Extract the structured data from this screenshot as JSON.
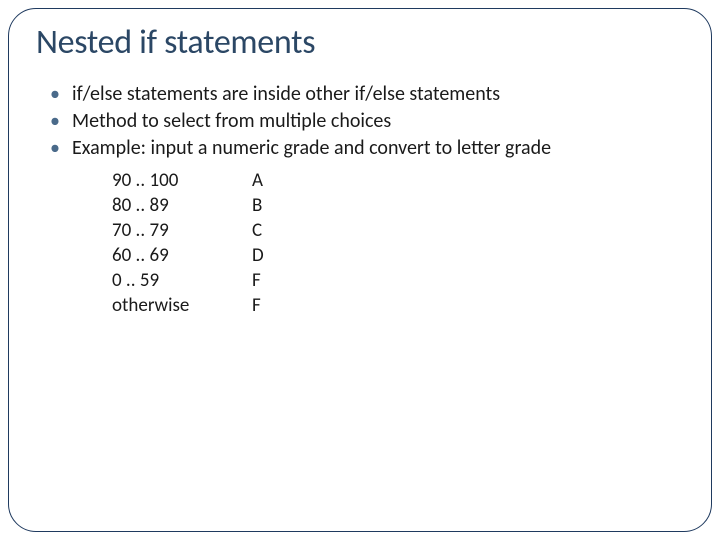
{
  "title": "Nested if statements",
  "bullets": [
    "if/else statements are inside other if/else statements",
    "Method to select from multiple choices",
    "Example: input a numeric grade and convert to letter grade"
  ],
  "grade_rows": [
    {
      "range": "90 .. 100",
      "letter": "A"
    },
    {
      "range": "80 .. 89",
      "letter": "B"
    },
    {
      "range": "70 .. 79",
      "letter": "C"
    },
    {
      "range": "60 .. 69",
      "letter": "D"
    },
    {
      "range": "0   .. 59",
      "letter": "F"
    },
    {
      "range": "otherwise",
      "letter": "F"
    }
  ]
}
